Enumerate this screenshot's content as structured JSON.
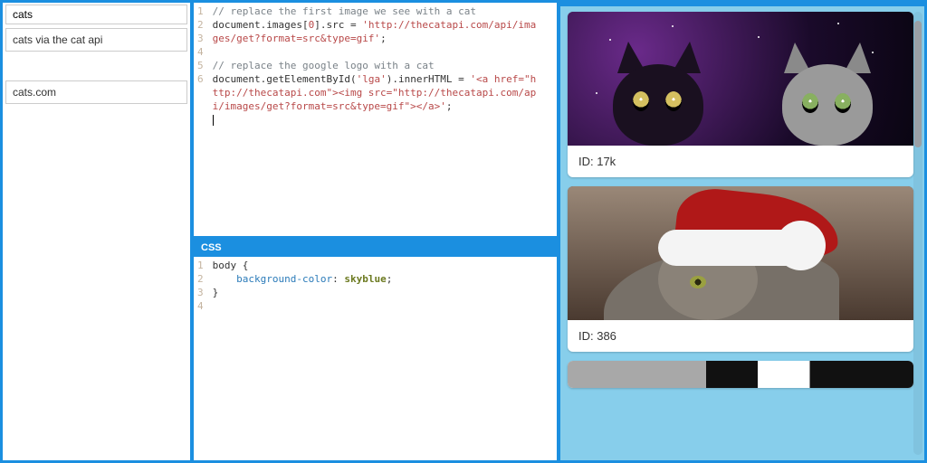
{
  "sidebar": {
    "search_value": "cats",
    "items": [
      {
        "label": "cats via the cat api"
      },
      {
        "label": "cats.com"
      }
    ]
  },
  "editors": {
    "js": {
      "lines": {
        "n1": "1",
        "n2": "2",
        "n3": "3",
        "n4": "4",
        "n5": "5",
        "n6": "6"
      },
      "code": {
        "l1_comment": "// replace the first image we see with a cat",
        "l2_a": "document.images[",
        "l2_b": "0",
        "l2_c": "].src = ",
        "l2_str": "'http://thecatapi.com/api/images/get?format=src&type=gif'",
        "l2_end": ";",
        "l4_comment": "// replace the google logo with a cat",
        "l5_a": "document.getElementById(",
        "l5_arg": "'lga'",
        "l5_b": ").innerHTML = ",
        "l5_str": "'<a href=\"http://thecatapi.com\"><img src=\"http://thecatapi.com/api/images/get?format=src&type=gif\"></a>'",
        "l5_end": ";"
      }
    },
    "css": {
      "header": "CSS",
      "lines": {
        "n1": "1",
        "n2": "2",
        "n3": "3",
        "n4": "4"
      },
      "code": {
        "l1": "body {",
        "l2_prop": "    background-color",
        "l2_sep": ": ",
        "l2_val": "skyblue",
        "l2_end": ";",
        "l3": "}"
      }
    }
  },
  "preview": {
    "cards": [
      {
        "label": "ID: 17k"
      },
      {
        "label": "ID: 386"
      }
    ]
  }
}
